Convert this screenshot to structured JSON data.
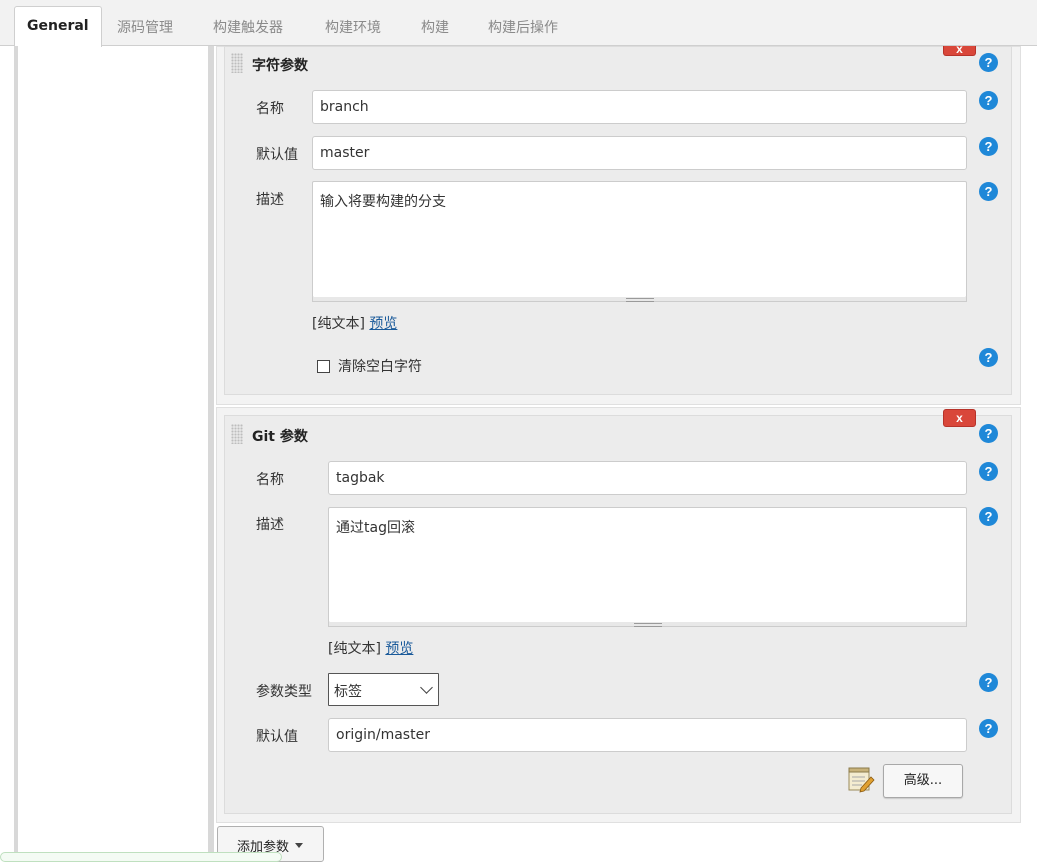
{
  "tabs": [
    {
      "label": "General",
      "active": true
    },
    {
      "label": "源码管理"
    },
    {
      "label": "构建触发器"
    },
    {
      "label": "构建环境"
    },
    {
      "label": "构建"
    },
    {
      "label": "构建后操作"
    }
  ],
  "string_param": {
    "title": "字符参数",
    "delete_label": "x",
    "name_label": "名称",
    "name_value": "branch",
    "default_label": "默认值",
    "default_value": "master",
    "desc_label": "描述",
    "desc_value": "输入将要构建的分支",
    "format_hint": "[纯文本]",
    "preview_link": "预览",
    "trim_label": "清除空白字符",
    "trim_checked": false
  },
  "git_param": {
    "title": "Git 参数",
    "delete_label": "x",
    "name_label": "名称",
    "name_value": "tagbak",
    "desc_label": "描述",
    "desc_value": "通过tag回滚",
    "format_hint": "[纯文本]",
    "preview_link": "预览",
    "type_label": "参数类型",
    "type_value": "标签",
    "default_label": "默认值",
    "default_value": "origin/master",
    "advanced_label": "高级..."
  },
  "help_glyph": "?",
  "add_param_label": "添加参数",
  "colors": {
    "help": "#1f88d8",
    "delete": "#d9473a",
    "link": "#1a5a9a"
  },
  "icons": [
    "help-icon",
    "delete-icon",
    "notepad-icon",
    "chevron-down-icon",
    "caret-down-icon",
    "drag-grip-icon"
  ]
}
